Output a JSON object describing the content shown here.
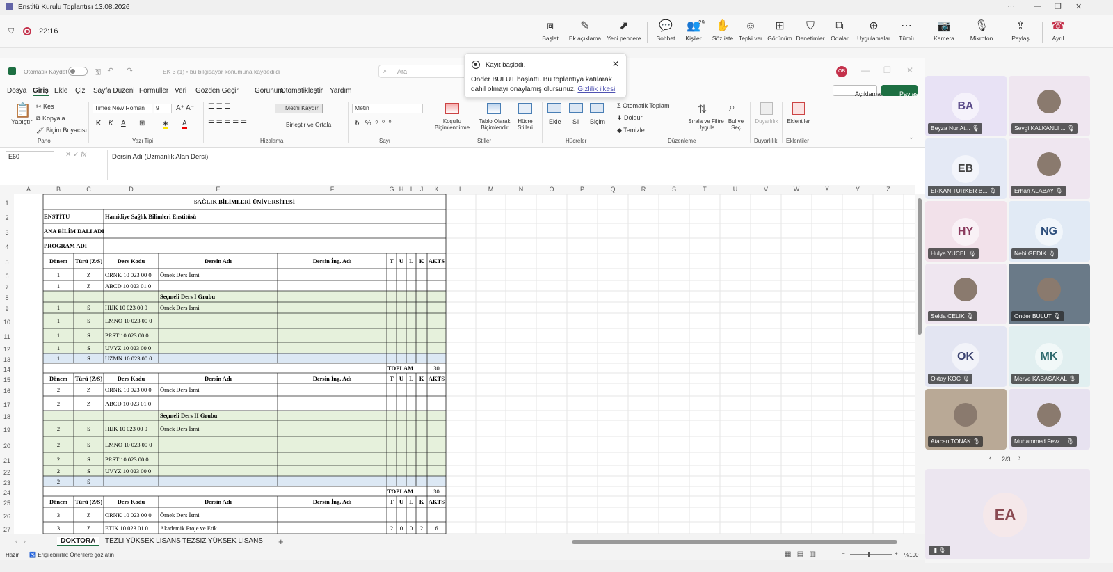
{
  "window": {
    "title": "Enstitü Kurulu Toplantısı 13.08.2026",
    "controls": [
      "···",
      "—",
      "❐",
      "✕"
    ]
  },
  "meeting": {
    "timer": "22:16",
    "buttons": [
      {
        "id": "start",
        "label": "Başlat",
        "icon": "share-screen-icon"
      },
      {
        "id": "annotate",
        "label": "Ek açıklama ...",
        "icon": "pen-icon"
      },
      {
        "id": "new-window",
        "label": "Yeni pencere",
        "icon": "popout-icon"
      },
      {
        "id": "chat",
        "label": "Sohbet",
        "icon": "chat-icon"
      },
      {
        "id": "people",
        "label": "Kişiler",
        "icon": "people-icon",
        "badge": "29"
      },
      {
        "id": "raise-hand",
        "label": "Söz iste",
        "icon": "hand-icon"
      },
      {
        "id": "react",
        "label": "Tepki ver",
        "icon": "smile-icon"
      },
      {
        "id": "view",
        "label": "Görünüm",
        "icon": "grid-icon"
      },
      {
        "id": "controls",
        "label": "Denetimler",
        "icon": "shield-icon"
      },
      {
        "id": "rooms",
        "label": "Odalar",
        "icon": "rooms-icon"
      },
      {
        "id": "apps",
        "label": "Uygulamalar",
        "icon": "plus-icon"
      },
      {
        "id": "more",
        "label": "Tümü",
        "icon": "more-icon"
      },
      {
        "id": "camera",
        "label": "Kamera",
        "icon": "camera-off-icon"
      },
      {
        "id": "mic",
        "label": "Mikrofon",
        "icon": "mic-off-icon"
      },
      {
        "id": "share",
        "label": "Paylaş",
        "icon": "share-icon"
      },
      {
        "id": "leave",
        "label": "Ayrıl",
        "icon": "phone-hangup-icon"
      }
    ]
  },
  "toast": {
    "title": "Kayıt başladı.",
    "body": "Onder BULUT başlattı. Bu toplantıya katılarak dahil olmayı onaylamış olursunuz.",
    "link": "Gizlilik ilkesi"
  },
  "excel": {
    "autosave": "Otomatik Kaydet",
    "file": "EK 3 (1) • bu bilgisayar konumuna kaydedildi",
    "search": "Ara",
    "user_badge": "OB",
    "comments_btn": "Açıklamalar",
    "share_btn": "Paylaş",
    "menu": [
      "Dosya",
      "Giriş",
      "Ekle",
      "Çiz",
      "Sayfa Düzeni",
      "Formüller",
      "Veri",
      "Gözden Geçir",
      "Görünüm",
      "Otomatikleştir",
      "Yardım"
    ],
    "ribbon": {
      "paste": "Yapıştır",
      "cut": "Kes",
      "copy": "Kopyala",
      "format_painter": "Biçim Boyacısı",
      "font": "Times New Roman",
      "size": "9",
      "wrap": "Metni Kaydır",
      "merge": "Birleştir ve Ortala",
      "numfmt": "Metin",
      "cond": "Koşullu Biçimlendirme",
      "table": "Tablo Olarak Biçimlendir",
      "cellstyles": "Hücre Stilleri",
      "insert": "Ekle",
      "delete": "Sil",
      "format": "Biçim",
      "autosum": "Otomatik Toplam",
      "fill": "Doldur",
      "clear": "Temizle",
      "sortfilter": "Sırala ve Filtre Uygula",
      "findselect": "Bul ve Seç",
      "sensitivity": "Duyarlılık",
      "addins": "Eklentiler",
      "groups": [
        "Pano",
        "Yazı Tipi",
        "Hizalama",
        "Sayı",
        "Stiller",
        "Hücreler",
        "Düzenleme",
        "Duyarlılık",
        "Eklentiler"
      ]
    },
    "namebox": "E60",
    "formula": "Dersin Adı (Uzmanlık Alan Dersi)",
    "cols": [
      "A",
      "B",
      "C",
      "D",
      "E",
      "F",
      "G",
      "H",
      "I",
      "J",
      "K",
      "L",
      "M",
      "N",
      "O",
      "P",
      "Q",
      "R",
      "S",
      "T",
      "U",
      "V",
      "W",
      "X",
      "Y",
      "Z"
    ],
    "rows": [
      "1",
      "2",
      "3",
      "4",
      "5",
      "6",
      "7",
      "8",
      "9",
      "10",
      "11",
      "12",
      "13",
      "14",
      "15",
      "16",
      "17",
      "18",
      "19",
      "20",
      "21",
      "22",
      "23",
      "24",
      "25",
      "26",
      "27"
    ],
    "sheet": {
      "university": "SAĞLIK BİLİMLERİ ÜNİVERSİTESİ",
      "institute_label": "ENSTİTÜ",
      "institute": "Hamidiye Sağlık Bilimleri Enstitüsü",
      "dept_label": "ANA BİLİM DALI ADI",
      "program_label": "PROGRAM ADI",
      "headers": [
        "Dönem",
        "Türü (Z/S)",
        "Ders Kodu",
        "Dersin Adı",
        "Dersin İng. Adı",
        "T",
        "U",
        "L",
        "K",
        "AKTS"
      ],
      "b1": [
        [
          "1",
          "Z",
          "ORNK 10 023 00 0",
          "Örnek Ders İsmi"
        ],
        [
          "1",
          "Z",
          "ABCD 10 023 01 0",
          ""
        ]
      ],
      "g1": "Seçmeli Ders I Grubu",
      "s1": [
        [
          "1",
          "S",
          "HIJK 10 023 00 0",
          "Örnek Ders İsmi"
        ],
        [
          "1",
          "S",
          "LMNO 10 023 00 0",
          ""
        ],
        [
          "1",
          "S",
          "PRST 10 023 00 0",
          ""
        ],
        [
          "1",
          "S",
          "UVYZ 10 023 00 0",
          ""
        ],
        [
          "1",
          "S",
          "UZMN 10 023 00 0",
          ""
        ]
      ],
      "total_label": "TOPLAM",
      "total1": "30",
      "b2": [
        [
          "2",
          "Z",
          "ORNK 10 023 00 0",
          "Örnek Ders İsmi"
        ],
        [
          "2",
          "Z",
          "ABCD 10 023 01 0",
          ""
        ]
      ],
      "g2": "Seçmeli Ders II Grubu",
      "s2": [
        [
          "2",
          "S",
          "HIJK 10 023 00 0",
          "Örnek Ders İsmi"
        ],
        [
          "2",
          "S",
          "LMNO 10 023 00 0",
          ""
        ],
        [
          "2",
          "S",
          "PRST 10 023 00 0",
          ""
        ],
        [
          "2",
          "S",
          "UVYZ 10 023 00 0",
          ""
        ],
        [
          "2",
          "S",
          "",
          ""
        ]
      ],
      "total2": "30",
      "b3": [
        [
          "3",
          "Z",
          "ORNK 10 023 00 0",
          "Örnek Ders İsmi",
          "",
          "",
          "",
          "",
          "",
          ""
        ],
        [
          "3",
          "Z",
          "ETIK 10 023 01 0",
          "Akademik Proje ve Etik",
          "",
          "2",
          "0",
          "0",
          "2",
          "6"
        ]
      ]
    },
    "tabs": [
      "DOKTORA",
      "TEZLİ YÜKSEK LİSANS",
      "TEZSİZ YÜKSEK LİSANS"
    ],
    "status": {
      "ready": "Hazır",
      "access": "Erişilebilirlik: Önerilere göz atın",
      "zoom": "%100"
    }
  },
  "participants": [
    {
      "name": "Beyza Nur At...",
      "init": "BA",
      "bg": "#e8e2f5",
      "fg": "#5b4b8a"
    },
    {
      "name": "Sevgi KALKANLI ...",
      "init": "",
      "bg": "#efe6f0",
      "fg": "#444",
      "photo": true
    },
    {
      "name": "ERKAN TURKER B...",
      "init": "EB",
      "bg": "#e4e9f5",
      "fg": "#444"
    },
    {
      "name": "Erhan ALABAY",
      "init": "",
      "bg": "#efe6f0",
      "fg": "#444",
      "photo": true
    },
    {
      "name": "Hulya YUCEL",
      "init": "HY",
      "bg": "#f2e1ea",
      "fg": "#8a3b5e"
    },
    {
      "name": "Nebi GEDIK",
      "init": "NG",
      "bg": "#e1eaf5",
      "fg": "#2d4f7c"
    },
    {
      "name": "Selda CELIK",
      "init": "",
      "bg": "#efe6f0",
      "fg": "#444",
      "photo": true
    },
    {
      "name": "Onder BULUT",
      "init": "",
      "bg": "#6a7a88",
      "fg": "#fff",
      "photo": true
    },
    {
      "name": "Oktay KOC",
      "init": "OK",
      "bg": "#e3e5f2",
      "fg": "#3b4270"
    },
    {
      "name": "Merve KABASAKAL",
      "init": "MK",
      "bg": "#e1eff0",
      "fg": "#2f6a6e"
    },
    {
      "name": "Atacan TONAK",
      "init": "",
      "bg": "#b9a996",
      "fg": "#fff",
      "photo": true
    },
    {
      "name": "Muhammed Fevz...",
      "init": "",
      "bg": "#e7e2f0",
      "fg": "#444",
      "photo": true
    }
  ],
  "pager": "2/3",
  "self": {
    "init": "EA"
  }
}
